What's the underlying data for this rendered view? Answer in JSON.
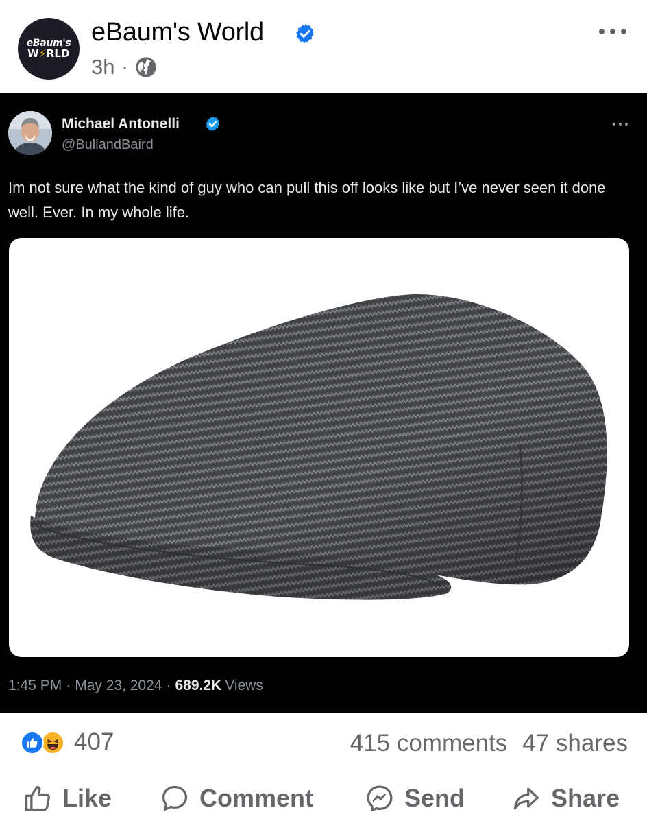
{
  "post": {
    "page_name": "eBaum's World",
    "avatar_line1": "eBaum's",
    "avatar_line2_a": "W",
    "avatar_line2_bolt": "⚡",
    "avatar_line2_b": "RLD",
    "time": "3h",
    "separator": "·",
    "privacy_icon": "globe-icon",
    "verified": true
  },
  "tweet": {
    "author_name": "Michael Antonelli",
    "handle": "@BullandBaird",
    "verified": true,
    "text": "Im not sure what the kind of guy who can pull this off looks like but I’ve never seen it done well. Ever. In my whole life.",
    "media_description_icon": "flat-cap-image",
    "time": "1:45 PM",
    "date": "May 23, 2024",
    "dot": "·",
    "views_count": "689.2K",
    "views_label": "Views"
  },
  "engagement": {
    "reaction_icons": [
      "like-reaction-icon",
      "haha-reaction-icon"
    ],
    "reaction_count": "407",
    "comments": "415 comments",
    "shares": "47 shares"
  },
  "actions": {
    "like": "Like",
    "comment": "Comment",
    "send": "Send",
    "share": "Share"
  },
  "colors": {
    "facebook_blue": "#1877f2",
    "secondary_text": "#65676b",
    "tweet_bg": "#000000",
    "twitter_blue": "#1d9bf0"
  }
}
